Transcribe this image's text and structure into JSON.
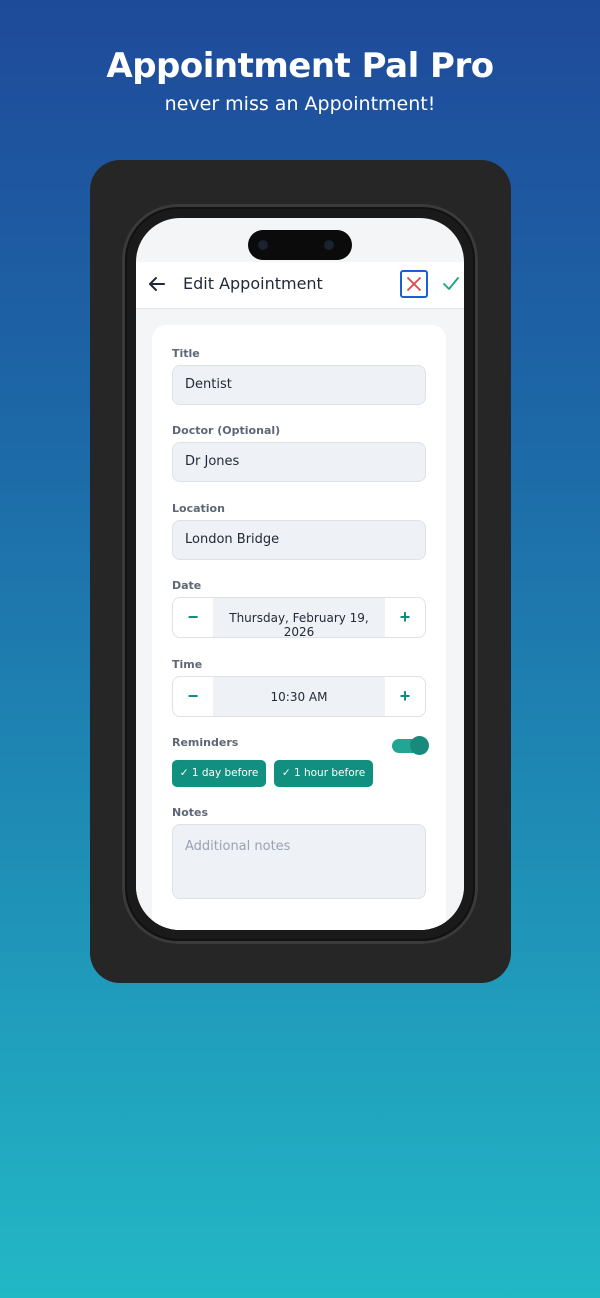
{
  "hero": {
    "title": "Appointment Pal Pro",
    "subtitle": "never miss an Appointment!"
  },
  "appbar": {
    "title": "Edit Appointment",
    "back_icon": "arrow-left-icon",
    "cancel_icon": "close-icon",
    "save_icon": "check-icon"
  },
  "form": {
    "title": {
      "label": "Title",
      "value": "Dentist"
    },
    "doctor": {
      "label": "Doctor (Optional)",
      "value": "Dr Jones"
    },
    "location": {
      "label": "Location",
      "value": "London Bridge"
    },
    "date": {
      "label": "Date",
      "value": "Thursday, February 19, 2026",
      "minus": "−",
      "plus": "+"
    },
    "time": {
      "label": "Time",
      "value": "10:30 AM",
      "minus": "−",
      "plus": "+"
    },
    "reminders": {
      "label": "Reminders",
      "enabled": true,
      "chips": [
        {
          "label": "✓ 1 day before"
        },
        {
          "label": "✓ 1 hour before"
        }
      ]
    },
    "notes": {
      "label": "Notes",
      "placeholder": "Additional notes",
      "value": ""
    }
  },
  "colors": {
    "accent": "#12907f",
    "cancel_border": "#1a5fd6",
    "cancel_x": "#e04848",
    "save_check": "#1aa37f"
  }
}
